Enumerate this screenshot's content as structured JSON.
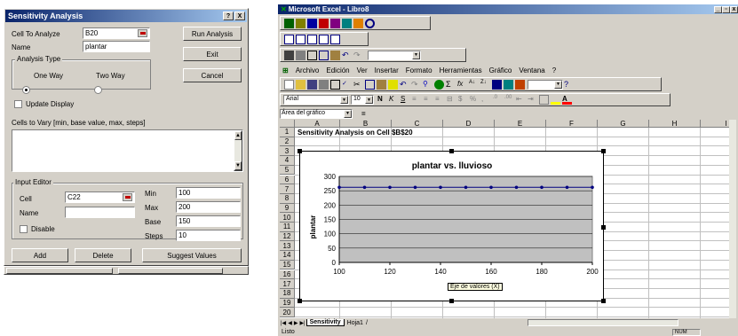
{
  "dialog": {
    "title": "Sensitivity Analysis",
    "help_btn": "?",
    "close_btn": "X",
    "cell_label": "Cell To Analyze",
    "cell_value": "B20",
    "name_label": "Name",
    "name_value": "plantar",
    "run_btn": "Run Analysis",
    "exit_btn": "Exit",
    "cancel_btn": "Cancel",
    "analysis_type_label": "Analysis Type",
    "one_way": "One Way",
    "two_way": "Two Way",
    "update_display": "Update Display",
    "cells_to_vary": "Cells to Vary [min, base value, max, steps]",
    "input_editor": "Input Editor",
    "ie_cell_label": "Cell",
    "ie_cell_value": "C22",
    "ie_name_label": "Name",
    "ie_name_value": "",
    "disable_label": "Disable",
    "min_label": "Min",
    "min_value": "100",
    "max_label": "Max",
    "max_value": "200",
    "base_label": "Base",
    "base_value": "150",
    "steps_label": "Steps",
    "steps_value": "10",
    "add_btn": "Add",
    "delete_btn": "Delete",
    "suggest_btn": "Suggest Values"
  },
  "excel": {
    "title": "Microsoft Excel - Libro8",
    "menu": [
      "Archivo",
      "Edición",
      "Ver",
      "Insertar",
      "Formato",
      "Herramientas",
      "Gráfico",
      "Ventana",
      "?"
    ],
    "font_name": "Arial",
    "font_size": "10",
    "name_box": "Área del gráfico",
    "columns": [
      "A",
      "B",
      "C",
      "D",
      "E",
      "F",
      "G",
      "H",
      "I"
    ],
    "rows": [
      "1",
      "2",
      "3",
      "4",
      "5",
      "6",
      "7",
      "8",
      "9",
      "10",
      "11",
      "12",
      "13",
      "14",
      "15",
      "16",
      "17",
      "18",
      "19",
      "20"
    ],
    "a1_text": "Sensitivity Analysis on Cell $B$20",
    "sheet_tab_active": "Sensitivity",
    "sheet_tab_other": "Hoja1",
    "status_left": "Listo",
    "status_right": "NUM",
    "tooltip": "Eje de valores (X)"
  },
  "chart_data": {
    "type": "line",
    "title": "plantar vs. lluvioso",
    "xlabel": "",
    "ylabel": "plantar",
    "x": [
      100,
      110,
      120,
      130,
      140,
      150,
      160,
      170,
      180,
      190,
      200
    ],
    "series": [
      {
        "values": [
          262,
          262,
          262,
          262,
          262,
          262,
          262,
          262,
          262,
          262,
          262
        ]
      }
    ],
    "xticks": [
      100,
      120,
      140,
      160,
      180,
      200
    ],
    "yticks": [
      0,
      50,
      100,
      150,
      200,
      250,
      300
    ],
    "xlim": [
      100,
      200
    ],
    "ylim": [
      0,
      300
    ],
    "grid": "horizontal",
    "plot_bg": "#c0c0c0",
    "line_color": "#000080"
  }
}
